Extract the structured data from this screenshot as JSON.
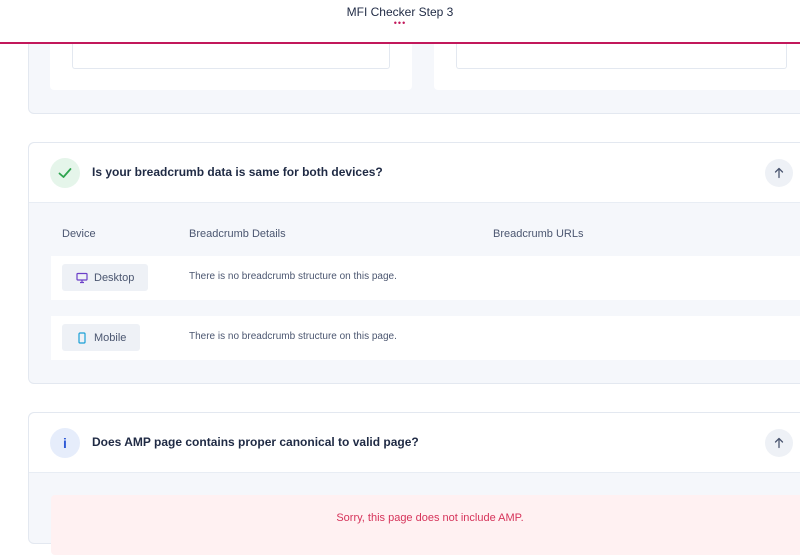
{
  "header": {
    "title": "MFI Checker Step 3",
    "dots": "•••"
  },
  "breadcrumb_check": {
    "question": "Is your breadcrumb data is same for both devices?",
    "status_icon": "check-icon",
    "columns": [
      "Device",
      "Breadcrumb Details",
      "Breadcrumb URLs"
    ],
    "rows": [
      {
        "device": "Desktop",
        "icon": "desktop-icon",
        "details": "There is no breadcrumb structure on this page.",
        "urls": ""
      },
      {
        "device": "Mobile",
        "icon": "mobile-icon",
        "details": "There is no breadcrumb structure on this page.",
        "urls": ""
      }
    ]
  },
  "amp_check": {
    "question": "Does AMP page contains proper canonical to valid page?",
    "status_icon": "info-icon",
    "status_glyph": "i",
    "message": "Sorry, this page does not include AMP."
  },
  "colors": {
    "accent": "#c2185b",
    "success": "#2ea44f",
    "info": "#2f5ad6",
    "error_text": "#d6335a",
    "error_bg": "#fff1f2"
  }
}
